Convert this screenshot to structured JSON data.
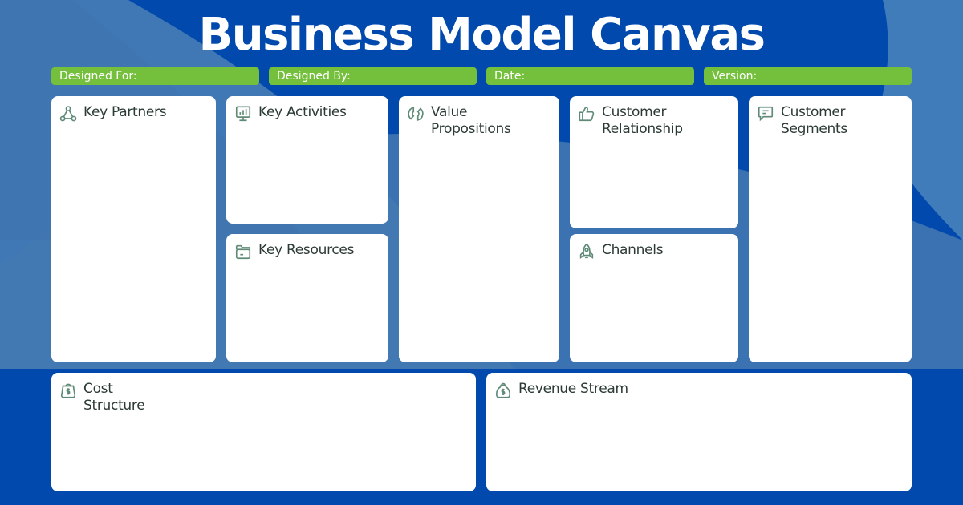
{
  "title": "Business Model Canvas",
  "colors": {
    "background": "#0249ad",
    "meta_bar": "#74bf3c",
    "card": "#ffffff",
    "icon": "#5e8a76",
    "card_text": "#2c3a35"
  },
  "meta_fields": [
    {
      "label": "Designed For:",
      "value": ""
    },
    {
      "label": "Designed By:",
      "value": ""
    },
    {
      "label": "Date:",
      "value": ""
    },
    {
      "label": "Version:",
      "value": ""
    }
  ],
  "blocks": {
    "key_partners": {
      "title": "Key Partners",
      "icon": "network-icon",
      "content": ""
    },
    "key_activities": {
      "title": "Key Activities",
      "icon": "presentation-chart-icon",
      "content": ""
    },
    "key_resources": {
      "title": "Key Resources",
      "icon": "folder-icon",
      "content": ""
    },
    "value_propositions": {
      "title": "Value\nPropositions",
      "icon": "cycle-icon",
      "content": ""
    },
    "customer_relationship": {
      "title": "Customer\nRelationship",
      "icon": "thumbs-up-icon",
      "content": ""
    },
    "channels": {
      "title": "Channels",
      "icon": "rocket-icon",
      "content": ""
    },
    "customer_segments": {
      "title": "Customer\nSegments",
      "icon": "chat-icon",
      "content": ""
    },
    "cost_structure": {
      "title": "Cost\nStructure",
      "icon": "money-bag-icon",
      "content": ""
    },
    "revenue_stream": {
      "title": "Revenue Stream",
      "icon": "money-bag-icon",
      "content": ""
    }
  }
}
